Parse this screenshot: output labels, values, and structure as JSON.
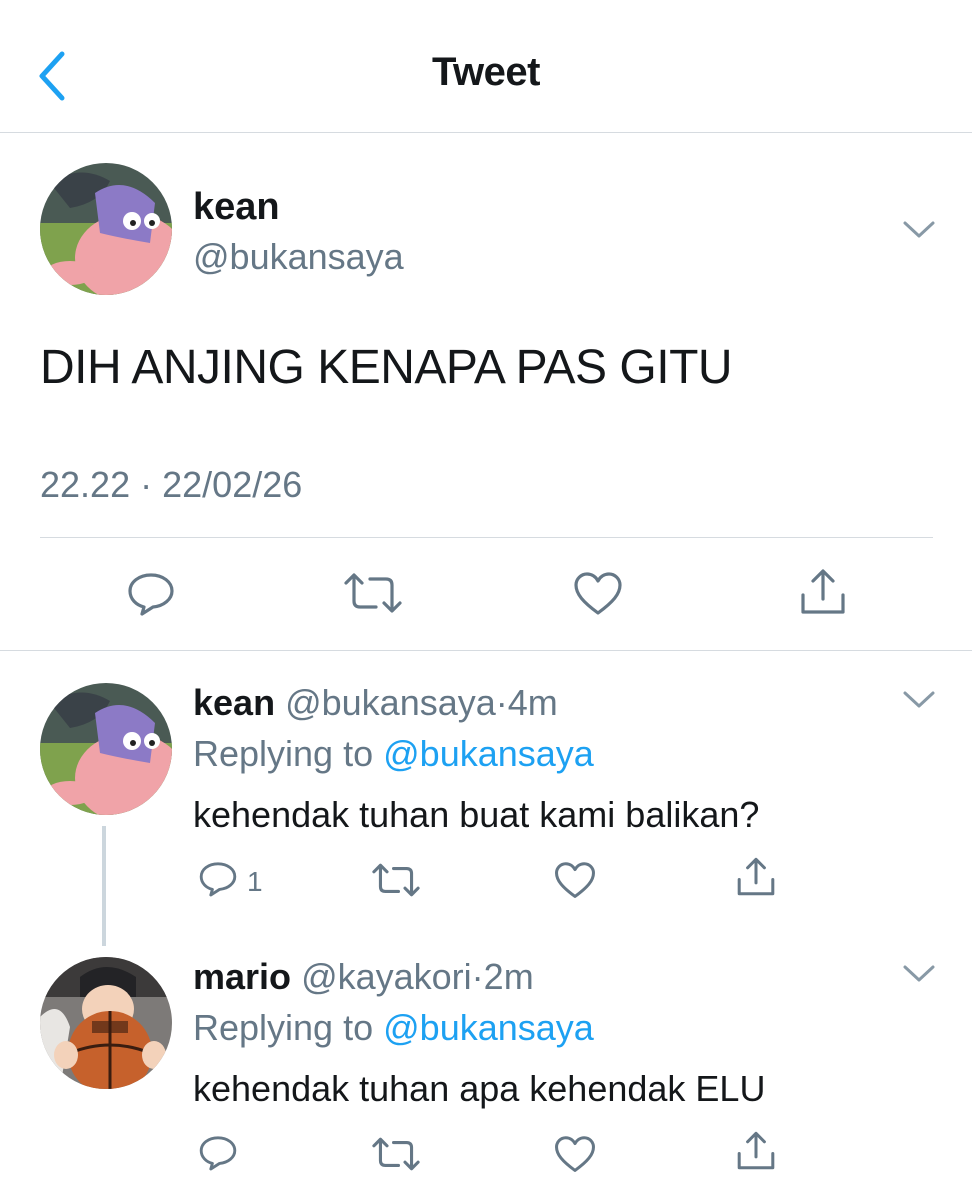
{
  "header": {
    "title": "Tweet"
  },
  "main_tweet": {
    "name": "kean",
    "handle": "@bukansaya",
    "text": "DIH ANJING KENAPA PAS GITU",
    "time": "22.22",
    "separator": "·",
    "date": "22/02/26"
  },
  "replies": [
    {
      "name": "kean",
      "handle": "@bukansaya",
      "separator": "·",
      "age": "4m",
      "replying_prefix": "Replying to",
      "replying_to": "@bukansaya",
      "text": "kehendak tuhan buat kami balikan?",
      "reply_count": "1"
    },
    {
      "name": "mario",
      "handle": "@kayakori",
      "separator": "·",
      "age": "2m",
      "replying_prefix": "Replying to",
      "replying_to": "@bukansaya",
      "text": "kehendak tuhan apa kehendak ELU",
      "reply_count": ""
    }
  ],
  "colors": {
    "accent": "#1da1f2",
    "muted": "#657786",
    "text": "#14171a",
    "divider": "#d6dbe0"
  },
  "icons": [
    "back-chevron-icon",
    "chevron-down-icon",
    "reply-icon",
    "retweet-icon",
    "like-icon",
    "share-icon"
  ]
}
